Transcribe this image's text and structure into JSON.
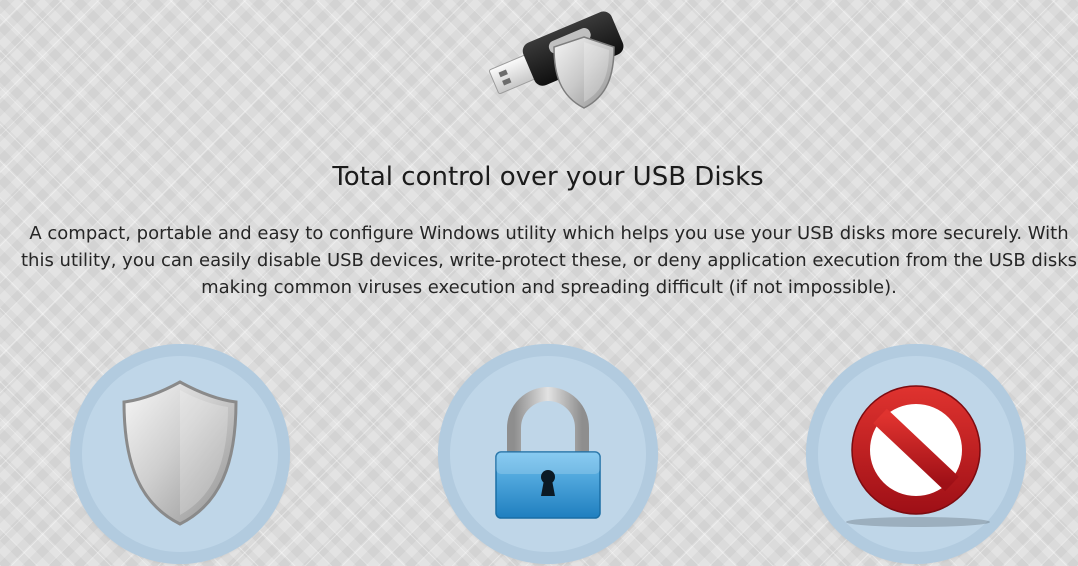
{
  "headline": "Total control over your USB Disks",
  "description": {
    "line1": "A compact, portable and easy to configure Windows utility which helps you use your USB disks more securely. With",
    "line2": "this utility, you can easily disable USB devices, write-protect these, or deny application execution from the USB disks",
    "line3": "making common viruses execution and spreading difficult (if not impossible)."
  },
  "icons": {
    "hero": "usb-drive-shield-icon",
    "feature1": "shield-icon",
    "feature2": "padlock-icon",
    "feature3": "prohibited-icon"
  },
  "colors": {
    "circle_fill": "#bfd6e8",
    "circle_ring": "#b2cbdf",
    "lock_body": "#2f97d6",
    "prohibit_red": "#c4171f",
    "usb_body": "#1e1e1e"
  }
}
